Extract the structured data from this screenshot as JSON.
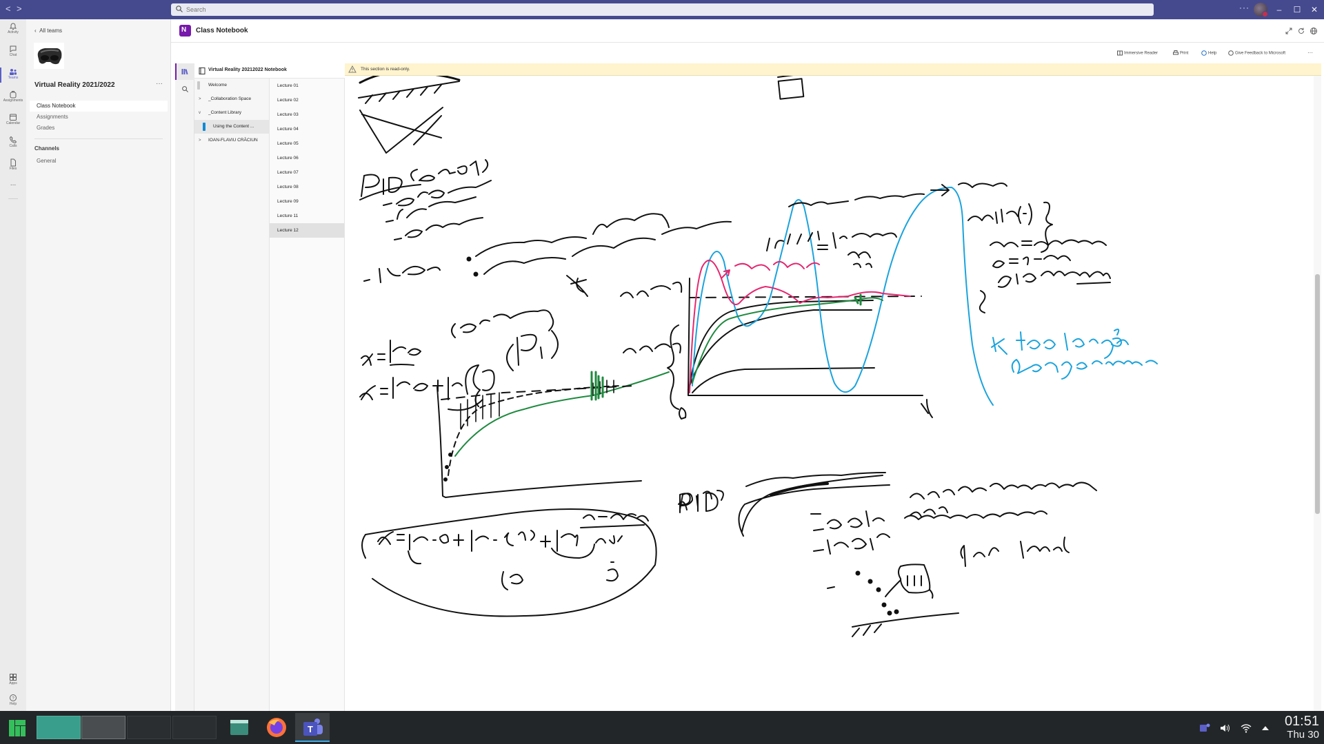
{
  "titlebar": {
    "search_placeholder": "Search",
    "more": "···",
    "window_controls": {
      "minimize": "–",
      "maximize": "☐",
      "close": "✕"
    }
  },
  "rail": [
    {
      "label": "Activity",
      "icon": "bell-icon"
    },
    {
      "label": "Chat",
      "icon": "chat-icon"
    },
    {
      "label": "Teams",
      "icon": "teams-icon",
      "active": true
    },
    {
      "label": "Assignments",
      "icon": "backpack-icon"
    },
    {
      "label": "Calendar",
      "icon": "calendar-icon"
    },
    {
      "label": "Calls",
      "icon": "phone-icon"
    },
    {
      "label": "Files",
      "icon": "file-icon"
    },
    {
      "label": "...",
      "icon": "more-icon"
    },
    {
      "label": "Apps",
      "icon": "apps-icon"
    },
    {
      "label": "Help",
      "icon": "help-icon"
    }
  ],
  "teampane": {
    "back": "All teams",
    "team_name": "Virtual Reality 2021/2022",
    "team_more": "···",
    "links": [
      {
        "label": "Class Notebook",
        "selected": true
      },
      {
        "label": "Assignments"
      },
      {
        "label": "Grades"
      }
    ],
    "channels_heading": "Channels",
    "channels": [
      {
        "label": "General"
      }
    ]
  },
  "header": {
    "title": "Class Notebook"
  },
  "toolbar": {
    "immersive_reader": "Immersive Reader",
    "print": "Print",
    "help": "Help",
    "feedback": "Give Feedback to Microsoft",
    "more": "···"
  },
  "notebook": {
    "name": "Virtual Reality 20212022 Notebook",
    "sections": [
      {
        "label": "Welcome",
        "chev": "",
        "bar_color": "#c8c8c8"
      },
      {
        "label": "_Collaboration Space",
        "chev": ">"
      },
      {
        "label": "_Content Library",
        "chev": "v"
      },
      {
        "label": "Using the Content ...",
        "chev": "",
        "bar_color": "#0f8ad4",
        "selected": true,
        "indent": true
      },
      {
        "label": "IOAN-FLAVIU CRĂCIUN",
        "chev": ">"
      }
    ],
    "pages": [
      "Lecture 01",
      "Lecture 02",
      "Lecture 03",
      "Lecture 04",
      "Lecture 05",
      "Lecture 06",
      "Lecture 07",
      "Lecture 08",
      "Lecture 09",
      "Lecture 11",
      "Lecture 12"
    ],
    "selected_page": "Lecture 12"
  },
  "notice": "This section is read-only.",
  "colors": {
    "accent": "#5b5fc7",
    "onenote": "#7719aa",
    "ink_black": "#111111",
    "ink_blue": "#1aa3dc",
    "ink_pink": "#e6266e",
    "ink_green": "#1f8a3f",
    "notice_bg": "#fff4ce"
  },
  "taskbar": {
    "time": "01:51",
    "date": "Thu 30"
  }
}
